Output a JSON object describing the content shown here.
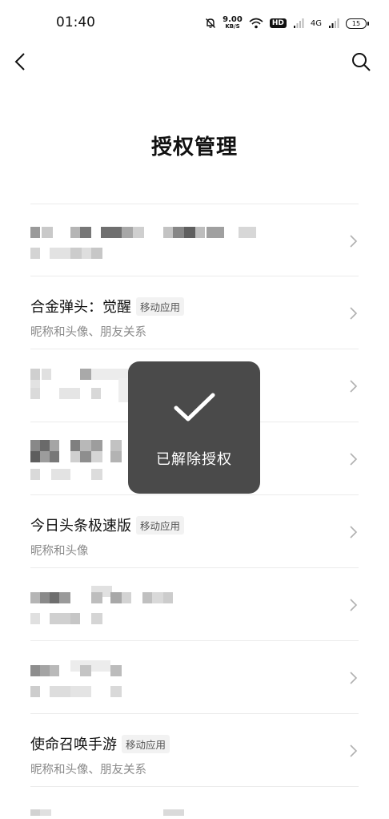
{
  "status_bar": {
    "time": "01:40",
    "speed_value": "9.00",
    "speed_unit": "KB/S",
    "hd_label": "HD",
    "network_label": "4G",
    "battery": "15"
  },
  "header": {
    "title": "授权管理"
  },
  "list": {
    "items": [
      {
        "name": "",
        "tag": "",
        "permissions": "",
        "redacted": true
      },
      {
        "name": "合金弹头：觉醒",
        "tag": "移动应用",
        "permissions": "昵称和头像、朋友关系",
        "redacted": false
      },
      {
        "name": "",
        "tag": "",
        "permissions": "",
        "redacted": true
      },
      {
        "name": "",
        "tag": "",
        "permissions": "",
        "redacted": true
      },
      {
        "name": "今日头条极速版",
        "tag": "移动应用",
        "permissions": "昵称和头像",
        "redacted": false
      },
      {
        "name": "",
        "tag": "",
        "permissions": "",
        "redacted": true
      },
      {
        "name": "",
        "tag": "",
        "permissions": "",
        "redacted": true
      },
      {
        "name": "使命召唤手游",
        "tag": "移动应用",
        "permissions": "昵称和头像、朋友关系",
        "redacted": false
      }
    ]
  },
  "toast": {
    "message": "已解除授权"
  },
  "colors": {
    "toast_bg": "#4a4a4a",
    "secondary_text": "#8a8a8a",
    "divider": "#ebebeb"
  }
}
